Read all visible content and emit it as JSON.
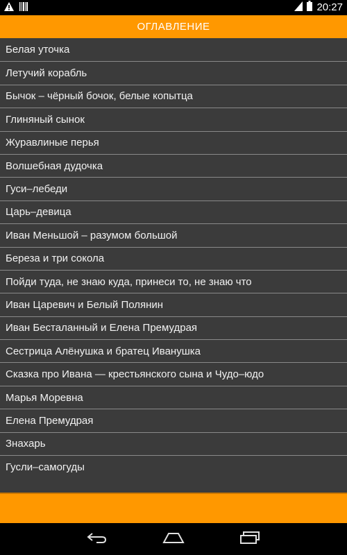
{
  "status_bar": {
    "time": "20:27",
    "icons": [
      "warning-icon",
      "barcode-icon",
      "sim-icon",
      "battery-icon"
    ]
  },
  "header": {
    "title": "ОГЛАВЛЕНИЕ"
  },
  "toc": {
    "items": [
      "Белая уточка",
      "Летучий корабль",
      "Бычок – чёрный бочок, белые копытца",
      "Глиняный сынок",
      "Журавлиные перья",
      "Волшебная дудочка",
      "Гуси–лебеди",
      "Царь–девица",
      "Иван Меньшой – разумом большой",
      "Береза и три сокола",
      "Пойди туда, не знаю куда, принеси то, не знаю что",
      "Иван Царевич и Белый Полянин",
      "Иван Бесталанный и Елена Премудрая",
      "Сестрица Алёнушка и братец Иванушка",
      "Сказка про Ивана — крестьянского сына и Чудо–юдо",
      "Марья Моревна",
      "Елена Премудрая",
      "Знахарь",
      "Гусли–самогуды"
    ]
  },
  "nav_bar": {
    "icons": [
      "back-icon",
      "home-icon",
      "recent-apps-icon"
    ]
  },
  "colors": {
    "accent": "#FF9800",
    "list_background": "#3b3b3b",
    "divider": "#8a8a8a",
    "text": "#f2f2f2"
  }
}
